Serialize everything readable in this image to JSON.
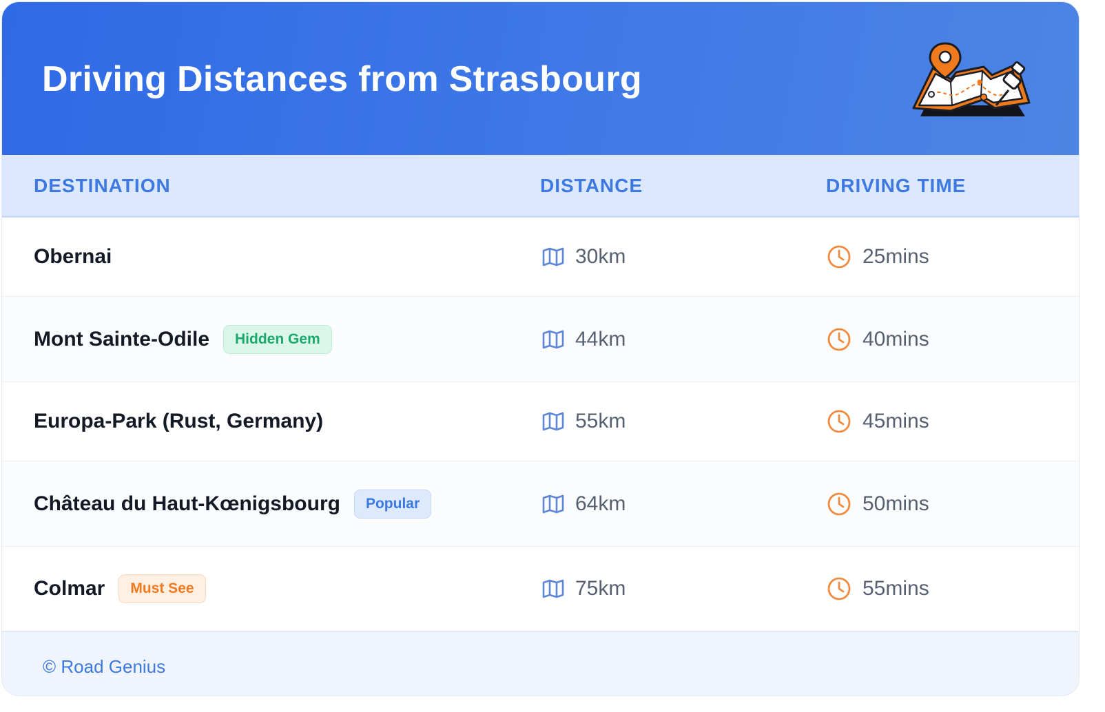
{
  "header": {
    "title": "Driving Distances from Strasbourg",
    "illustration_icon": "folded-map-with-pins-icon"
  },
  "table": {
    "columns": {
      "destination": "DESTINATION",
      "distance": "DISTANCE",
      "time": "DRIVING TIME"
    },
    "rows": [
      {
        "destination": "Obernai",
        "badge": "",
        "distance": "30km",
        "time": "25mins"
      },
      {
        "destination": "Mont Sainte-Odile",
        "badge": "Hidden Gem",
        "badge_color": "#1aa86b",
        "distance": "44km",
        "time": "40mins"
      },
      {
        "destination": "Europa-Park (Rust, Germany)",
        "badge": "",
        "distance": "55km",
        "time": "45mins"
      },
      {
        "destination": "Château du Haut-Kœnigsbourg",
        "badge": "Popular",
        "badge_color": "#3b78df",
        "distance": "64km",
        "time": "50mins"
      },
      {
        "destination": "Colmar",
        "badge": "Must See",
        "badge_color": "#f07a1e",
        "distance": "75km",
        "time": "55mins"
      }
    ],
    "distance_icon": "map-icon",
    "time_icon": "clock-icon"
  },
  "footer": {
    "credit": "© Road Genius"
  },
  "colors": {
    "header": "#2f6ae6",
    "accent": "#3d79e0",
    "clock": "#f08a3e"
  }
}
